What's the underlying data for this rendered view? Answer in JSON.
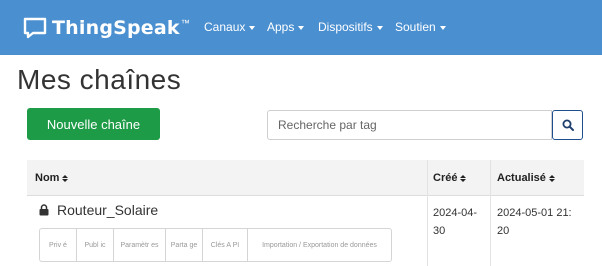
{
  "brand": {
    "name": "ThingSpeak",
    "tm": "™"
  },
  "nav": {
    "items": [
      {
        "label": "Canaux"
      },
      {
        "label": "Apps"
      },
      {
        "label": "Dispositifs"
      },
      {
        "label": "Soutien"
      }
    ]
  },
  "page": {
    "title": "Mes chaînes"
  },
  "toolbar": {
    "new_channel_label": "Nouvelle chaîne",
    "search_placeholder": "Recherche par tag"
  },
  "table": {
    "headers": {
      "name": "Nom",
      "created": "Créé",
      "updated": "Actualisé"
    },
    "rows": [
      {
        "name": "Routeur_Solaire",
        "created_line1": "2024-04-",
        "created_line2": "30",
        "updated_line1": "2024-05-01 21:",
        "updated_line2": "20",
        "tabs": [
          "Priv é",
          "Publ ic",
          "Paramètr es",
          "Parta ge",
          "Clés A PI",
          "Importation / Exportation de données"
        ]
      }
    ]
  },
  "colors": {
    "navbar": "#4a8fd0",
    "primary_button": "#1e9b47"
  },
  "icons": {
    "brand": "chat-bubble-icon",
    "search": "search-icon",
    "lock": "lock-icon",
    "sort": "sort-icon",
    "dropdown": "caret-down-icon"
  }
}
